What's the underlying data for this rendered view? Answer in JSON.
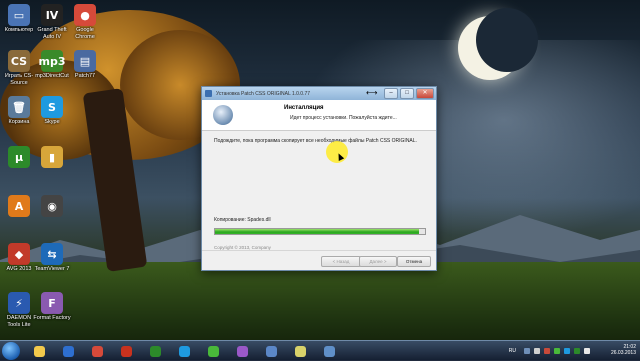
{
  "desktop": {
    "icons": [
      {
        "label": "Компьютер",
        "glyph": "▭",
        "color": "#4a74b5"
      },
      {
        "label": "Grand Theft Auto IV",
        "glyph": "IV",
        "color": "#222222"
      },
      {
        "label": "Google Chrome",
        "glyph": "●",
        "color": "#d64a3a"
      },
      {
        "label": "Играть CS-Source",
        "glyph": "CS",
        "color": "#8a6a3a"
      },
      {
        "label": "mp3DirectCut",
        "glyph": "mp3",
        "color": "#3a8a2a"
      },
      {
        "label": "Patch77",
        "glyph": "▤",
        "color": "#4a6aa0"
      },
      {
        "label": "Корзина",
        "glyph": "🗑",
        "color": "#5a7a9a"
      },
      {
        "label": "Skype",
        "glyph": "S",
        "color": "#1e9ae0"
      },
      {
        "label": "",
        "glyph": "μ",
        "color": "#2c8a2a"
      },
      {
        "label": "",
        "glyph": "▮",
        "color": "#d8a63a"
      },
      {
        "label": "",
        "glyph": "A",
        "color": "#e07a1a"
      },
      {
        "label": "",
        "glyph": "◉",
        "color": "#444444"
      },
      {
        "label": "AVG 2013",
        "glyph": "◆",
        "color": "#c23a2a"
      },
      {
        "label": "TeamViewer 7",
        "glyph": "⇆",
        "color": "#1e6ab8"
      },
      {
        "label": "DAEMON Tools Lite",
        "glyph": "⚡",
        "color": "#2a5ab0"
      },
      {
        "label": "Format Factory",
        "glyph": "F",
        "color": "#8a5ab0"
      }
    ]
  },
  "window": {
    "title": "Установка Patch CSS ORIGINAL 1.0.0.77",
    "minimize": "–",
    "maximize": "□",
    "close": "✕",
    "header_title": "Инсталляция",
    "header_subtitle": "Идет процесс установки. Пожалуйста ждите...",
    "body_text": "Подождите, пока программа скопирует все необходимые файлы Patch CSS ORIGINAL.",
    "copy_label": "Копирование: Spades.dll",
    "progress_fraction": 0.97,
    "copyright": "Copyright © 2013, Company",
    "back_button": "< Назад",
    "next_button": "Далее >",
    "cancel_button": "Отмена"
  },
  "taskbar": {
    "items": [
      {
        "name": "windows-explorer",
        "color": "#f2c94c"
      },
      {
        "name": "media-player",
        "color": "#2e6fd0"
      },
      {
        "name": "chrome",
        "color": "#d64a3a"
      },
      {
        "name": "filezilla",
        "color": "#c8321e"
      },
      {
        "name": "utorrent",
        "color": "#2c8a2a"
      },
      {
        "name": "skype",
        "color": "#1e9ae0"
      },
      {
        "name": "icq",
        "color": "#49b93a"
      },
      {
        "name": "winamp",
        "color": "#9a58c8"
      },
      {
        "name": "image-viewer",
        "color": "#5b87c7"
      },
      {
        "name": "notes",
        "color": "#d8d26a"
      },
      {
        "name": "installer",
        "color": "#5f8fc8"
      }
    ],
    "language": "RU",
    "time": "21:02",
    "date": "26.03.2013"
  }
}
